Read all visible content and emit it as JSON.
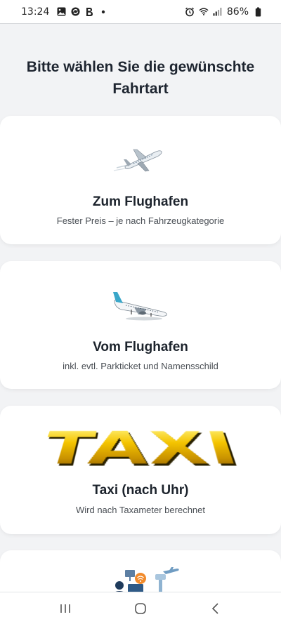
{
  "status_bar": {
    "time": "13:24",
    "battery": "86%",
    "icons_left": [
      "gallery-icon",
      "sync-icon",
      "b-app-icon",
      "dot-icon"
    ],
    "icons_right": [
      "alarm-icon",
      "wifi-icon",
      "signal-icon",
      "battery-icon"
    ]
  },
  "page": {
    "title": "Bitte wählen Sie die gewünschte Fahrtart"
  },
  "options": [
    {
      "title": "Zum Flughafen",
      "subtitle": "Fester Preis – je nach Fahrzeugkategorie",
      "image_icon": "departing-airplane-icon"
    },
    {
      "title": "Vom Flughafen",
      "subtitle": "inkl. evtl. Parkticket und Namensschild",
      "image_icon": "arriving-airplane-icon"
    },
    {
      "title": "Taxi (nach Uhr)",
      "subtitle": "Wird nach Taxameter berechnet",
      "image_icon": "taxi-logo",
      "logo_text": "TAXI"
    },
    {
      "image_icon": "airport-services-icon"
    }
  ],
  "colors": {
    "background": "#f2f3f5",
    "card": "#ffffff",
    "title_text": "#1e2530",
    "subtitle_text": "#4a4f55",
    "taxi_gold": "#f4c400",
    "plane_blue": "#3aa7c9"
  }
}
